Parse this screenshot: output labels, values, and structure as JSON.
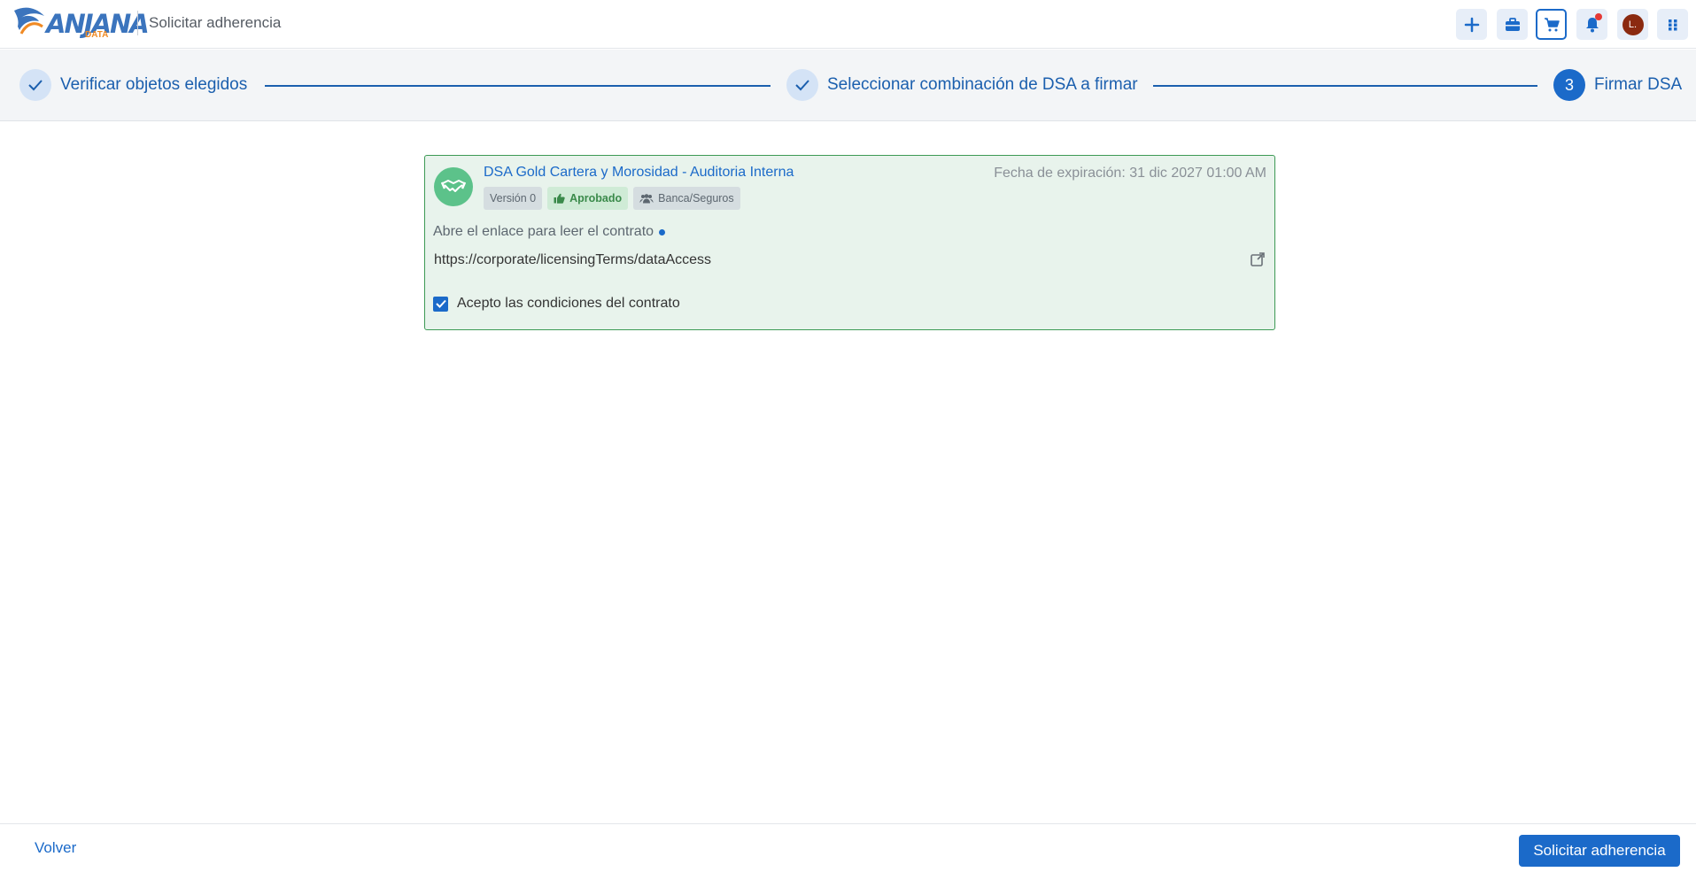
{
  "header": {
    "logo_text": "ANJANA",
    "logo_sub": "DATA",
    "title": "Solicitar adherencia",
    "buttons": [
      {
        "icon": "plus-icon"
      },
      {
        "icon": "briefcase-icon"
      },
      {
        "icon": "cart-icon"
      },
      {
        "icon": "bell-icon"
      },
      {
        "icon": "avatar"
      },
      {
        "icon": "apps-grid-icon"
      }
    ],
    "avatar_initial": "L."
  },
  "stepper": {
    "steps": [
      {
        "label": "Verificar objetos elegidos",
        "status": "done"
      },
      {
        "label": "Seleccionar combinación de DSA a firmar",
        "status": "done"
      },
      {
        "label": "Firmar DSA",
        "status": "active",
        "number": "3"
      }
    ]
  },
  "card": {
    "title": "DSA Gold Cartera y Morosidad - Auditoria Interna",
    "expiry": "Fecha de expiración: 31 dic 2027 01:00 AM",
    "chips": {
      "version": "Versión 0",
      "status": "Aprobado",
      "domain": "Banca/Seguros"
    },
    "contract_label": "Abre el enlace para leer el contrato",
    "contract_url": "https://corporate/licensingTerms/dataAccess",
    "accept_label": "Acepto las condiciones del contrato",
    "accepted": true
  },
  "footer": {
    "back_label": "Volver",
    "submit_label": "Solicitar adherencia"
  },
  "colors": {
    "accent": "#1b6ac9",
    "card_bg": "#e8f3ec",
    "card_border": "#3d9a55"
  }
}
